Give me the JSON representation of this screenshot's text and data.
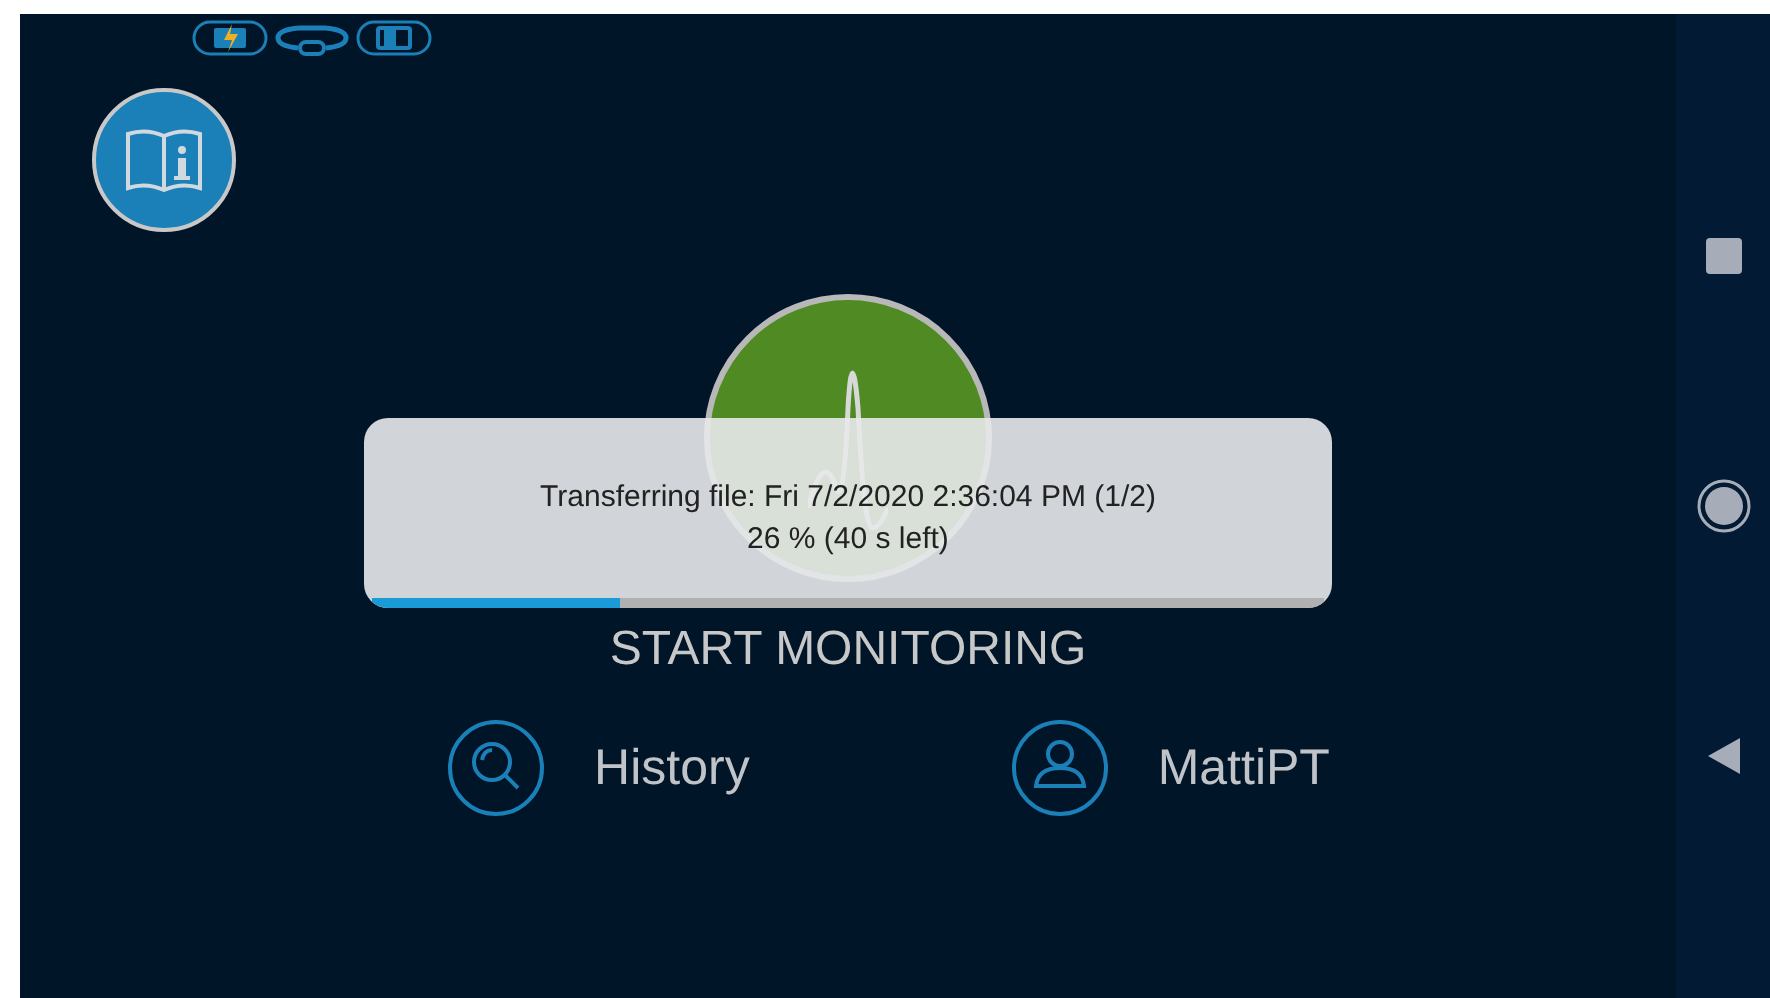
{
  "start_label": "START MONITORING",
  "menu": [
    {
      "kind": "history",
      "label": "History"
    },
    {
      "kind": "user",
      "label": "MattiPT"
    }
  ],
  "transfer_dialog": {
    "message": "Transferring file: Fri 7/2/2020 2:36:04 PM (1/2)",
    "progress_text": "26 % (40 s left)",
    "level": 0.26
  }
}
